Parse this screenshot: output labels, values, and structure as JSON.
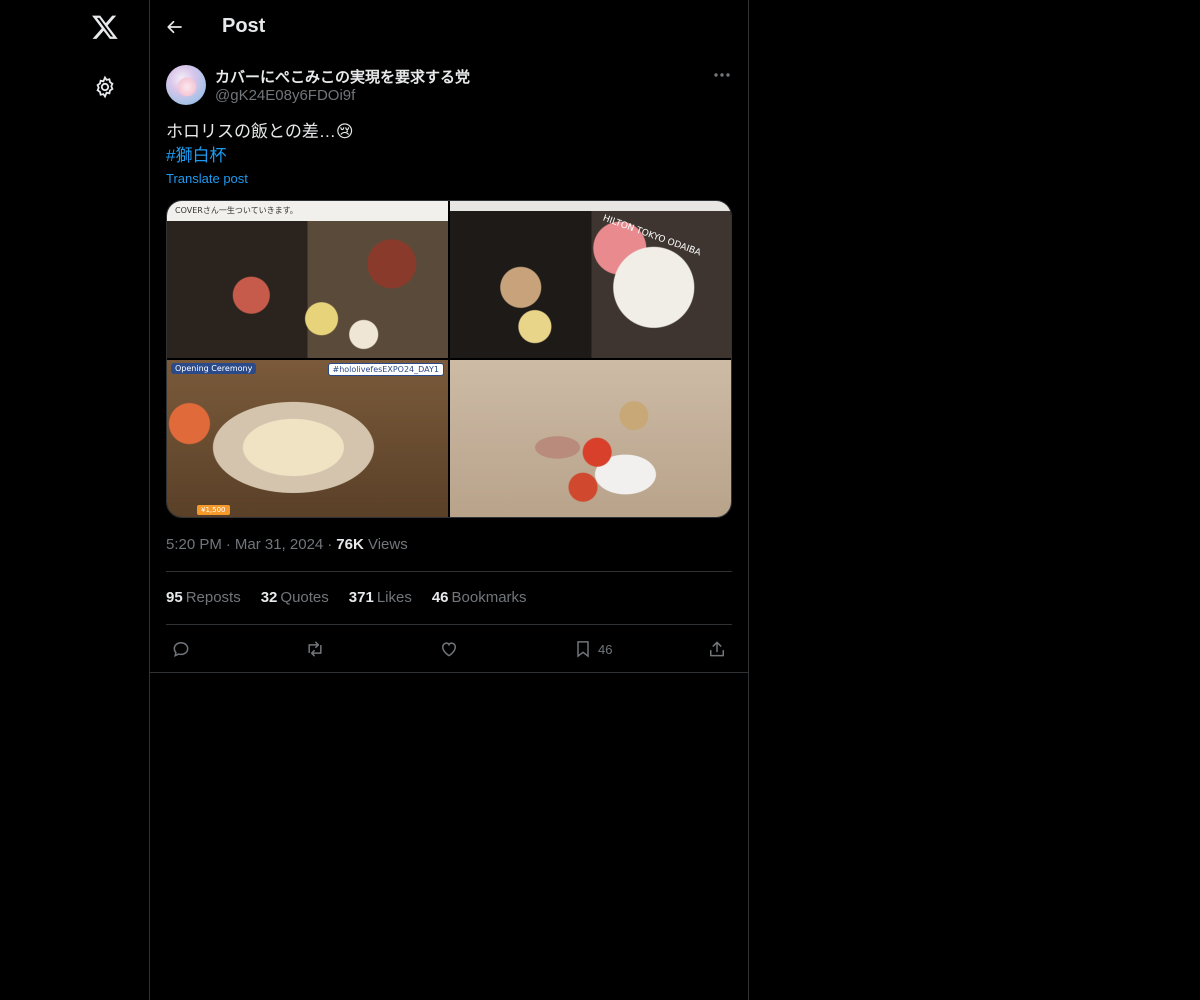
{
  "header": {
    "title": "Post"
  },
  "author": {
    "display_name": "カバーにぺこみこの実現を要求する党",
    "handle": "@gK24E08y6FDOi9f"
  },
  "post": {
    "text": "ホロリスの飯との差…😢",
    "hashtag": "#獅白杯",
    "translate_label": "Translate post",
    "media": [
      {
        "caption_top": "COVERさん一生ついていきます。"
      },
      {
        "caption_top": "HILTON TOKYO ODAIBA"
      },
      {
        "badge_left": "Opening Ceremony",
        "badge_right": "#hololivefesEXPO24_DAY1",
        "badge_bottom": "¥1,500"
      },
      {}
    ]
  },
  "meta": {
    "time": "5:20 PM",
    "date": "Mar 31, 2024",
    "views_count": "76K",
    "views_label": "Views"
  },
  "stats": {
    "reposts_count": "95",
    "reposts_label": "Reposts",
    "quotes_count": "32",
    "quotes_label": "Quotes",
    "likes_count": "371",
    "likes_label": "Likes",
    "bookmarks_count": "46",
    "bookmarks_label": "Bookmarks"
  },
  "actions": {
    "bookmark_count": "46"
  },
  "icons": [
    "x-logo-icon",
    "settings-gear-icon",
    "back-arrow-icon",
    "more-dots-icon",
    "reply-icon",
    "repost-icon",
    "like-heart-icon",
    "bookmark-icon",
    "share-icon"
  ],
  "colors": {
    "background": "#000000",
    "text": "#e7e9ea",
    "secondary": "#71767b",
    "link": "#1d9bf0",
    "border": "#2f3336"
  }
}
